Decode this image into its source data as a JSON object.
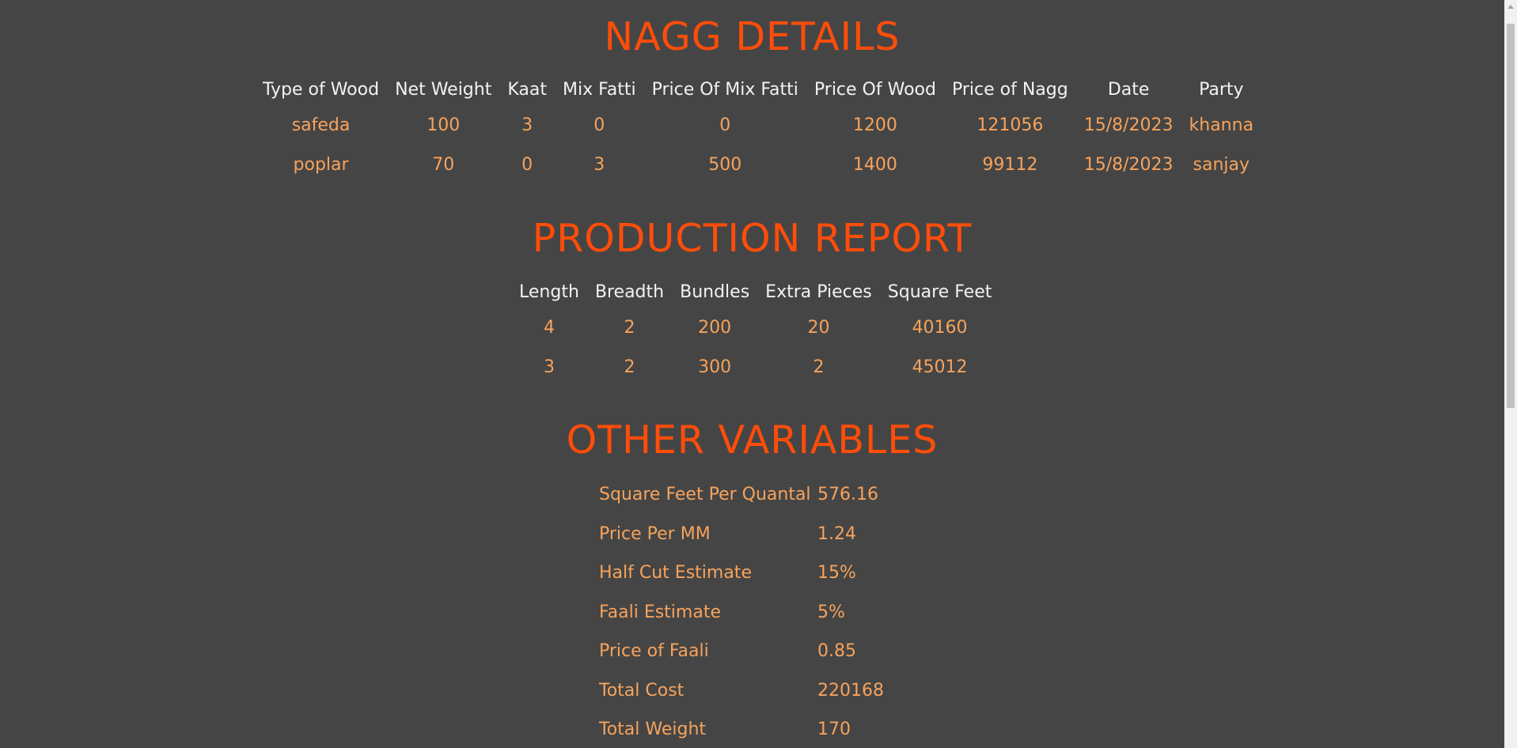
{
  "sections": {
    "nagg_title": "NAGG DETAILS",
    "production_title": "PRODUCTION REPORT",
    "other_title": "OTHER VARIABLES"
  },
  "nagg": {
    "headers": [
      "Type of Wood",
      "Net Weight",
      "Kaat",
      "Mix Fatti",
      "Price Of Mix Fatti",
      "Price Of Wood",
      "Price of Nagg",
      "Date",
      "Party"
    ],
    "rows": [
      [
        "safeda",
        "100",
        "3",
        "0",
        "0",
        "1200",
        "121056",
        "15/8/2023",
        "khanna"
      ],
      [
        "poplar",
        "70",
        "0",
        "3",
        "500",
        "1400",
        "99112",
        "15/8/2023",
        "sanjay"
      ]
    ]
  },
  "production": {
    "headers": [
      "Length",
      "Breadth",
      "Bundles",
      "Extra Pieces",
      "Square Feet"
    ],
    "rows": [
      [
        "4",
        "2",
        "200",
        "20",
        "40160"
      ],
      [
        "3",
        "2",
        "300",
        "2",
        "45012"
      ]
    ]
  },
  "other": {
    "items": [
      {
        "label": "Square Feet Per Quantal",
        "value": "576.16"
      },
      {
        "label": "Price Per MM",
        "value": "1.24"
      },
      {
        "label": "Half Cut Estimate",
        "value": "15%"
      },
      {
        "label": "Faali Estimate",
        "value": "5%"
      },
      {
        "label": "Price of Faali",
        "value": "0.85"
      },
      {
        "label": "Total Cost",
        "value": "220168"
      },
      {
        "label": "Total Weight",
        "value": "170"
      }
    ]
  },
  "colors": {
    "background": "#454545",
    "title": "#ff4d0a",
    "header_text": "#f2f2f2",
    "value_text": "#f7a35c"
  }
}
